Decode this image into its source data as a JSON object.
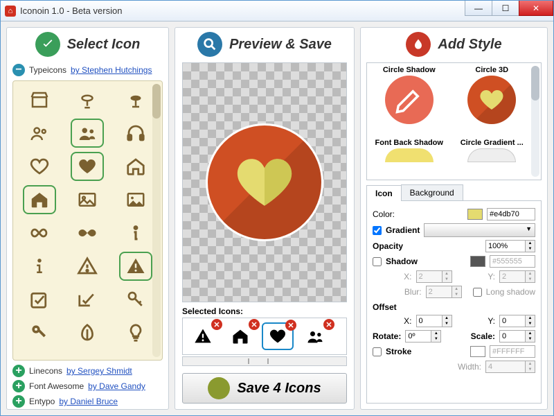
{
  "window": {
    "title": "Iconoin 1.0 - Beta version"
  },
  "headers": {
    "select": "Select Icon",
    "preview": "Preview & Save",
    "style": "Add Style"
  },
  "iconsets": {
    "open": {
      "name": "Typeicons",
      "author": "by Stephen Hutchings"
    },
    "closed": [
      {
        "name": "Linecons",
        "author": "by Sergey Shmidt"
      },
      {
        "name": "Font Awesome",
        "author": "by Dave Gandy"
      },
      {
        "name": "Entypo",
        "author": "by Daniel Bruce"
      }
    ]
  },
  "selected_label": "Selected Icons:",
  "save_label": "Save 4 Icons",
  "styles": {
    "tiles": [
      "Circle Shadow",
      "Circle 3D",
      "Font Back Shadow",
      "Circle Gradient ..."
    ]
  },
  "tabs": {
    "icon": "Icon",
    "background": "Background"
  },
  "form": {
    "color_label": "Color:",
    "color_value": "#e4db70",
    "gradient_label": "Gradient",
    "gradient_checked": true,
    "opacity_label": "Opacity",
    "opacity_value": "100%",
    "shadow_label": "Shadow",
    "shadow_checked": false,
    "shadow_color": "#555555",
    "shadow_x": "2",
    "shadow_y": "2",
    "shadow_blur": "2",
    "long_shadow_label": "Long shadow",
    "long_shadow_checked": false,
    "offset_label": "Offset",
    "offset_x": "0",
    "offset_y": "0",
    "rotate_label": "Rotate:",
    "rotate_value": "0º",
    "scale_label": "Scale:",
    "scale_value": "0",
    "stroke_label": "Stroke",
    "stroke_checked": false,
    "stroke_color": "#FFFFFF",
    "width_label": "Width:",
    "width_value": "4",
    "x_label": "X:",
    "y_label": "Y:",
    "blur_label": "Blur:"
  }
}
